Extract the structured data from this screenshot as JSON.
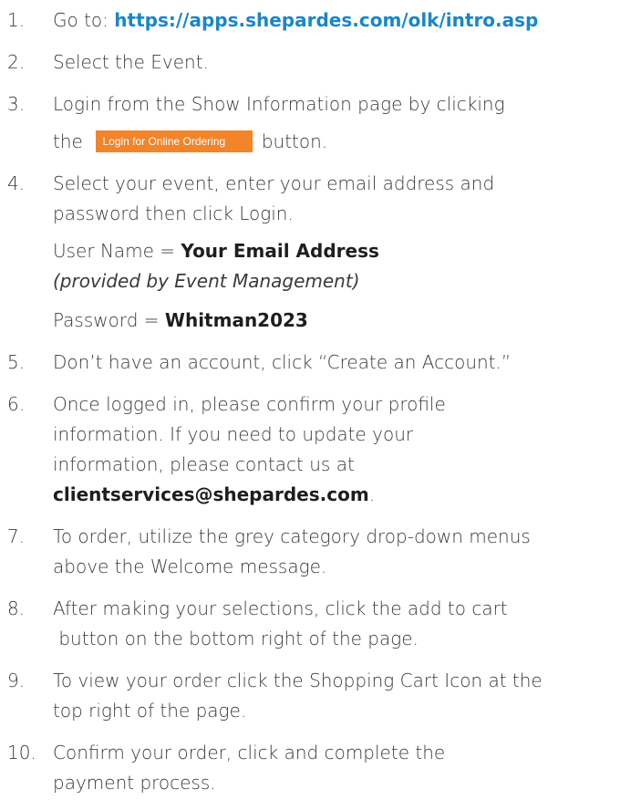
{
  "steps": [
    {
      "num": "1.",
      "prefix": "Go to: ",
      "url": "https://apps.shepardes.com/olk/intro.asp"
    },
    {
      "num": "2.",
      "text": "Select the Event."
    },
    {
      "num": "3.",
      "line1": "Login from the Show Information page by clicking",
      "before_button": "the",
      "button_label": "Login for Online Ordering",
      "after_button": "button."
    },
    {
      "num": "4.",
      "line1": "Select your event, enter your email address and",
      "line2": "password then click Login.",
      "username_label": "User Name = ",
      "username_value": "Your Email Address",
      "username_note": "(provided by Event Management)",
      "password_label": "Password = ",
      "password_value": "Whitman2023"
    },
    {
      "num": "5.",
      "text": "Don’t have an account, click “Create an Account.”"
    },
    {
      "num": "6.",
      "line1": "Once logged in, please confirm your profile",
      "line2": "information. If you need to update your",
      "line3": "information, please contact us at",
      "email": "clientservices@shepardes.com",
      "email_suffix": "."
    },
    {
      "num": "7.",
      "line1": "To order, utilize the grey category drop-down menus",
      "line2": "above the Welcome message."
    },
    {
      "num": "8.",
      "line1": "After making your selections, click the add to cart",
      "line2": " button on the bottom right of the page."
    },
    {
      "num": "9.",
      "line1": "To view your order click the Shopping Cart Icon at the",
      "line2": "top right of the page."
    },
    {
      "num": "10.",
      "line1": "Confirm your order, click and complete the",
      "line2": "payment process."
    }
  ]
}
